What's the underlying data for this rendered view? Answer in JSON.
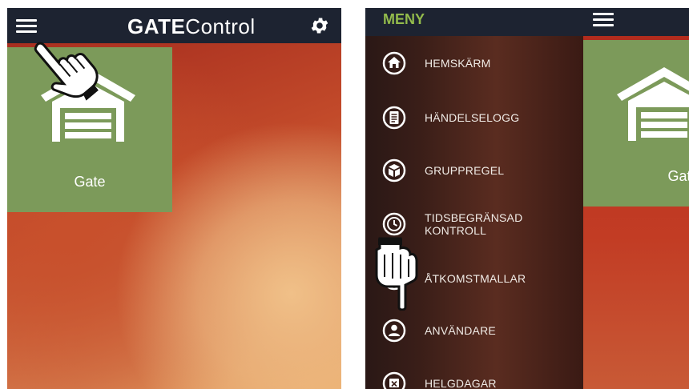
{
  "left_screen": {
    "header": {
      "title_bold": "GATE",
      "title_light": "Control"
    },
    "icons": {
      "menu": "hamburger-icon",
      "settings": "gear-icon",
      "pointer": "pointing-hand-icon",
      "garage": "garage-icon"
    },
    "tile": {
      "label": "Gate"
    }
  },
  "right_screen": {
    "drawer": {
      "title": "MENY",
      "items": [
        {
          "label": "HEMSKÄRM",
          "icon": "home-icon"
        },
        {
          "label": "HÄNDELSELOGG",
          "icon": "log-icon"
        },
        {
          "label": "GRUPPREGEL",
          "icon": "group-icon"
        },
        {
          "label": "TIDSBEGRÄNSAD KONTROLL",
          "icon": "clock-icon"
        },
        {
          "label": "ÅTKOMSTMALLAR",
          "icon": "template-icon"
        },
        {
          "label": "ANVÄNDARE",
          "icon": "user-icon"
        },
        {
          "label": "HELGDAGAR",
          "icon": "calendar-icon"
        }
      ]
    },
    "tile": {
      "label": "Gate"
    }
  },
  "colors": {
    "header_bg": "#1d2331",
    "menu_accent": "#93bb4c",
    "tile_green": "#7c9a5a"
  }
}
